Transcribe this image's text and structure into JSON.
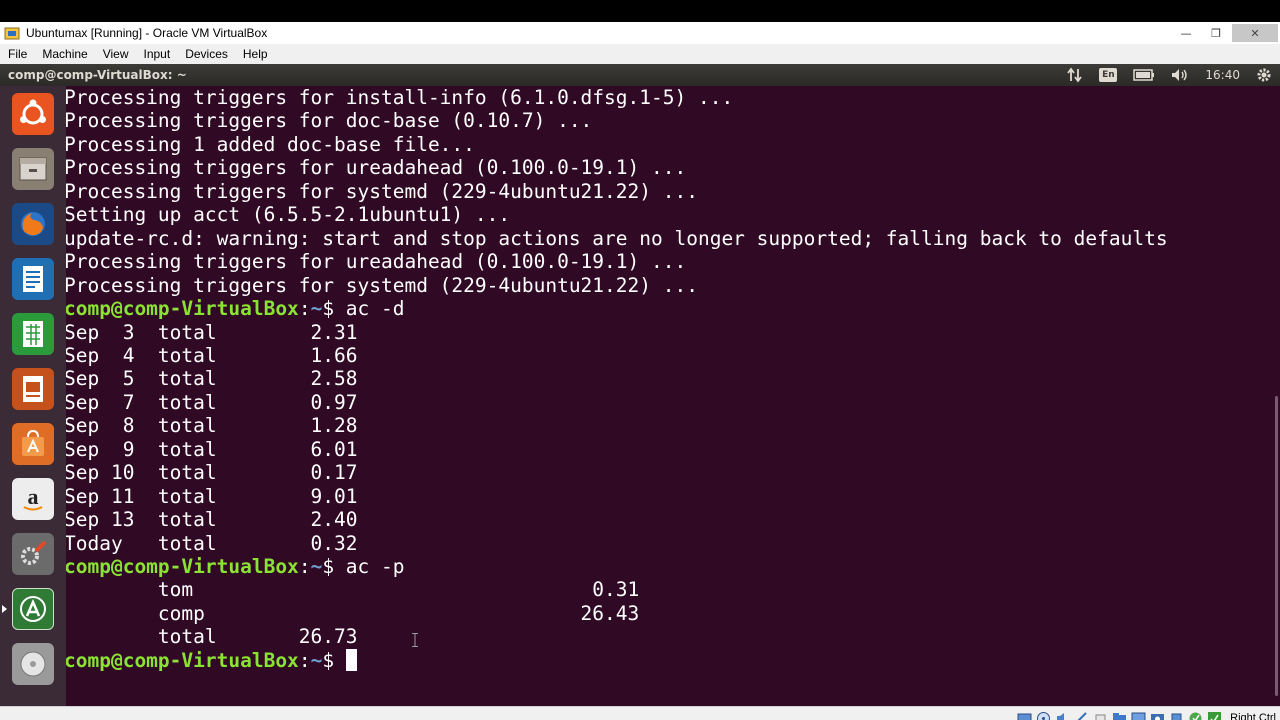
{
  "window": {
    "title": "Ubuntumax [Running] - Oracle VM VirtualBox",
    "controls": [
      "—",
      "❐",
      "✕"
    ]
  },
  "menubar": [
    "File",
    "Machine",
    "View",
    "Input",
    "Devices",
    "Help"
  ],
  "guest_topbar": {
    "title": "comp@comp-VirtualBox: ~",
    "keyboard_layout": "En",
    "clock": "16:40",
    "indicators": [
      "transfer-arrows-icon",
      "keyboard-layout-badge",
      "battery-icon",
      "speaker-icon",
      "gear-icon"
    ]
  },
  "launcher": {
    "items": [
      {
        "name": "ubuntu-dash-icon",
        "bg": "#e95420"
      },
      {
        "name": "files-icon",
        "bg": "#8a7f73"
      },
      {
        "name": "firefox-icon",
        "bg": "#1b4a87"
      },
      {
        "name": "writer-icon",
        "bg": "#1f6fb4"
      },
      {
        "name": "calc-icon",
        "bg": "#2a9a3a"
      },
      {
        "name": "impress-icon",
        "bg": "#c5511d"
      },
      {
        "name": "software-center-icon",
        "bg": "#e06d25"
      },
      {
        "name": "amazon-icon",
        "bg": "#ededed"
      },
      {
        "name": "system-settings-icon",
        "bg": "#6b6b6b"
      },
      {
        "name": "software-updater-icon",
        "bg": "#2f7a34"
      },
      {
        "name": "disc-icon",
        "bg": "#9a9a9a"
      }
    ]
  },
  "terminal": {
    "prompt_user": "comp@comp-VirtualBox",
    "prompt_sep": ":",
    "prompt_path": "~",
    "prompt_end": "$ ",
    "lines": [
      {
        "type": "text",
        "text": "Processing triggers for install-info (6.1.0.dfsg.1-5) ..."
      },
      {
        "type": "text",
        "text": "Processing triggers for doc-base (0.10.7) ..."
      },
      {
        "type": "text",
        "text": "Processing 1 added doc-base file..."
      },
      {
        "type": "text",
        "text": "Processing triggers for ureadahead (0.100.0-19.1) ..."
      },
      {
        "type": "text",
        "text": "Processing triggers for systemd (229-4ubuntu21.22) ..."
      },
      {
        "type": "text",
        "text": "Setting up acct (6.5.5-2.1ubuntu1) ..."
      },
      {
        "type": "text",
        "text": "update-rc.d: warning: start and stop actions are no longer supported; falling back to defaults"
      },
      {
        "type": "text",
        "text": "Processing triggers for ureadahead (0.100.0-19.1) ..."
      },
      {
        "type": "text",
        "text": "Processing triggers for systemd (229-4ubuntu21.22) ..."
      },
      {
        "type": "prompt",
        "command": "ac -d"
      },
      {
        "type": "text",
        "text": "Sep  3  total        2.31"
      },
      {
        "type": "text",
        "text": "Sep  4  total        1.66"
      },
      {
        "type": "text",
        "text": "Sep  5  total        2.58"
      },
      {
        "type": "text",
        "text": "Sep  7  total        0.97"
      },
      {
        "type": "text",
        "text": "Sep  8  total        1.28"
      },
      {
        "type": "text",
        "text": "Sep  9  total        6.01"
      },
      {
        "type": "text",
        "text": "Sep 10  total        0.17"
      },
      {
        "type": "text",
        "text": "Sep 11  total        9.01"
      },
      {
        "type": "text",
        "text": "Sep 13  total        2.40"
      },
      {
        "type": "text",
        "text": "Today   total        0.32"
      },
      {
        "type": "prompt",
        "command": "ac -p"
      },
      {
        "type": "text",
        "text": "        tom                                  0.31"
      },
      {
        "type": "text",
        "text": "        comp                                26.43"
      },
      {
        "type": "text",
        "text": "        total       26.73"
      },
      {
        "type": "prompt",
        "command": "",
        "cursor": true
      }
    ]
  },
  "statusbar": {
    "host_key": "Right Ctrl",
    "icons": [
      "hard-disk-icon",
      "optical-drive-icon",
      "audio-icon",
      "network-icon",
      "usb-icon",
      "shared-folders-icon",
      "display-icon",
      "video-capture-icon",
      "cpu-icon",
      "mouse-integration-icon",
      "keyboard-capture-icon"
    ]
  }
}
